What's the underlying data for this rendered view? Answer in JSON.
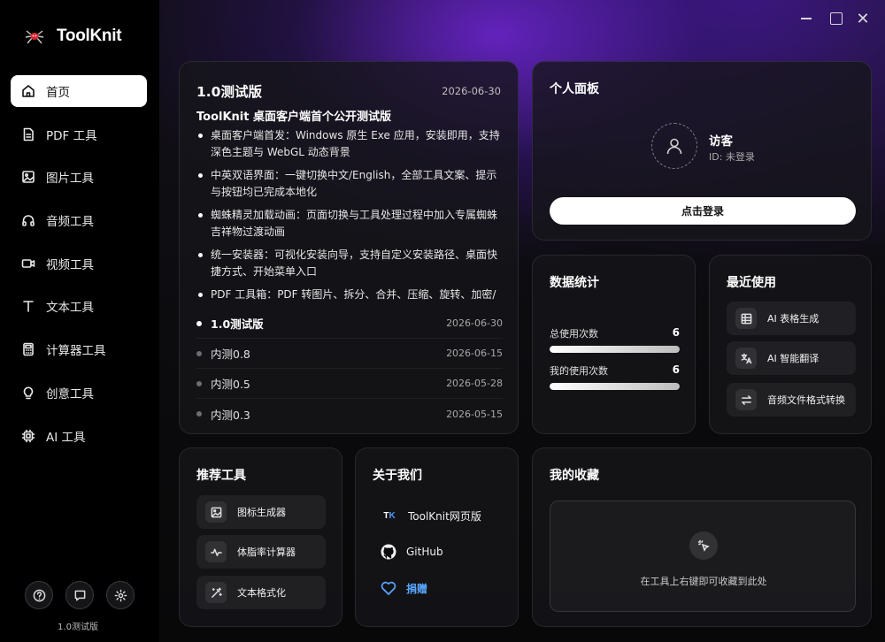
{
  "app": {
    "name": "ToolKnit",
    "version": "1.0测试版"
  },
  "sidebar": {
    "items": [
      {
        "label": "首页",
        "icon": "home-icon",
        "active": true
      },
      {
        "label": "PDF 工具",
        "icon": "document-icon"
      },
      {
        "label": "图片工具",
        "icon": "image-icon"
      },
      {
        "label": "音频工具",
        "icon": "headphones-icon"
      },
      {
        "label": "视频工具",
        "icon": "video-icon"
      },
      {
        "label": "文本工具",
        "icon": "text-icon"
      },
      {
        "label": "计算器工具",
        "icon": "calculator-icon"
      },
      {
        "label": "创意工具",
        "icon": "lightbulb-icon"
      },
      {
        "label": "AI 工具",
        "icon": "ai-chip-icon"
      }
    ],
    "bottom_icons": [
      "help-icon",
      "feedback-icon",
      "settings-icon"
    ]
  },
  "update_card": {
    "title": "1.0测试版",
    "date": "2026-06-30",
    "subtitle": "ToolKnit 桌面客户端首个公开测试版",
    "bullets": [
      "桌面客户端首发：Windows 原生 Exe 应用，安装即用，支持深色主题与 WebGL 动态背景",
      "中英双语界面：一键切换中文/English，全部工具文案、提示与按钮均已完成本地化",
      "蜘蛛精灵加载动画：页面切换与工具处理过程中加入专属蜘蛛吉祥物过渡动画",
      "统一安装器：可视化安装向导，支持自定义安装路径、桌面快捷方式、开始菜单入口",
      "PDF 工具箱：PDF 转图片、拆分、合并、压缩、旋转、加密/"
    ],
    "versions": [
      {
        "name": "1.0测试版",
        "date": "2026-06-30",
        "active": true
      },
      {
        "name": "内测0.8",
        "date": "2026-06-15"
      },
      {
        "name": "内测0.5",
        "date": "2026-05-28"
      },
      {
        "name": "内测0.3",
        "date": "2026-05-15"
      }
    ]
  },
  "personal_panel": {
    "title": "个人面板",
    "name": "访客",
    "id_text": "ID: 未登录",
    "login_label": "点击登录"
  },
  "stats": {
    "title": "数据统计",
    "rows": [
      {
        "label": "总使用次数",
        "value": "6",
        "fill": 1.0
      },
      {
        "label": "我的使用次数",
        "value": "6",
        "fill": 1.0
      }
    ]
  },
  "recent": {
    "title": "最近使用",
    "items": [
      {
        "label": "AI 表格生成",
        "icon": "table-icon"
      },
      {
        "label": "AI 智能翻译",
        "icon": "translate-icon"
      },
      {
        "label": "音频文件格式转换",
        "icon": "swap-icon"
      }
    ]
  },
  "recommended": {
    "title": "推荐工具",
    "items": [
      {
        "label": "图标生成器",
        "icon": "image-icon"
      },
      {
        "label": "体脂率计算器",
        "icon": "pulse-icon"
      },
      {
        "label": "文本格式化",
        "icon": "magic-wand-icon"
      }
    ]
  },
  "about": {
    "title": "关于我们",
    "links": [
      {
        "label": "ToolKnit网页版",
        "icon": "tk-logo-icon",
        "badge_t": "T",
        "badge_k": "K"
      },
      {
        "label": "GitHub",
        "icon": "github-icon"
      },
      {
        "label": "捐赠",
        "icon": "heart-icon"
      }
    ]
  },
  "favorites": {
    "title": "我的收藏",
    "hint": "在工具上右键即可收藏到此处"
  },
  "colors": {
    "accent_blue": "#5aa8ff",
    "brand_purple": "#7a2ee6"
  }
}
